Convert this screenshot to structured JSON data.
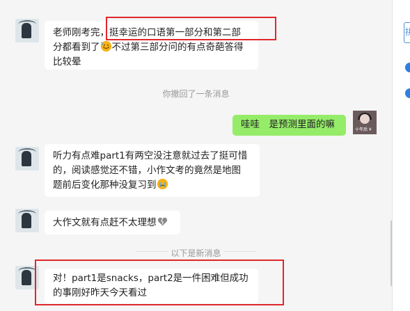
{
  "messages": [
    {
      "id": "m1",
      "from": "other",
      "lines": [
        "老师刚考完，挺幸运的口语第一部分和第二部",
        "分都看到了",
        "不过第三部分问的有点奇葩答得",
        "比较晕"
      ],
      "emoji_name": "sweat-smile-emoji"
    },
    {
      "id": "s1",
      "type": "system",
      "text": "你撤回了一条消息"
    },
    {
      "id": "m2",
      "from": "me",
      "text": "哇哇　是预测里面的嘛",
      "avatar_caption": "十年后 ¥"
    },
    {
      "id": "m3",
      "from": "other",
      "lines": [
        "听力有点难part1有两空没注意就过去了挺可惜",
        "的，阅读感觉还不错，小作文考的竟然是地图",
        "题前后变化那种没复习到"
      ],
      "emoji_name": "crying-emoji"
    },
    {
      "id": "m4",
      "from": "other",
      "text": "大作文就有点赶不太理想",
      "emoji_name": "broken-heart-emoji"
    },
    {
      "id": "s2",
      "type": "divider",
      "text": "以下是新消息"
    },
    {
      "id": "m5",
      "from": "other",
      "lines": [
        "对！part1是snacks，part2是一件困难但成功",
        "的事刚好昨天今天看过"
      ]
    }
  ],
  "sidebar": {
    "tab_label": "拼"
  },
  "colors": {
    "green_bubble": "#95ec69",
    "highlight": "#e0262a",
    "background": "#f5f5f5"
  }
}
